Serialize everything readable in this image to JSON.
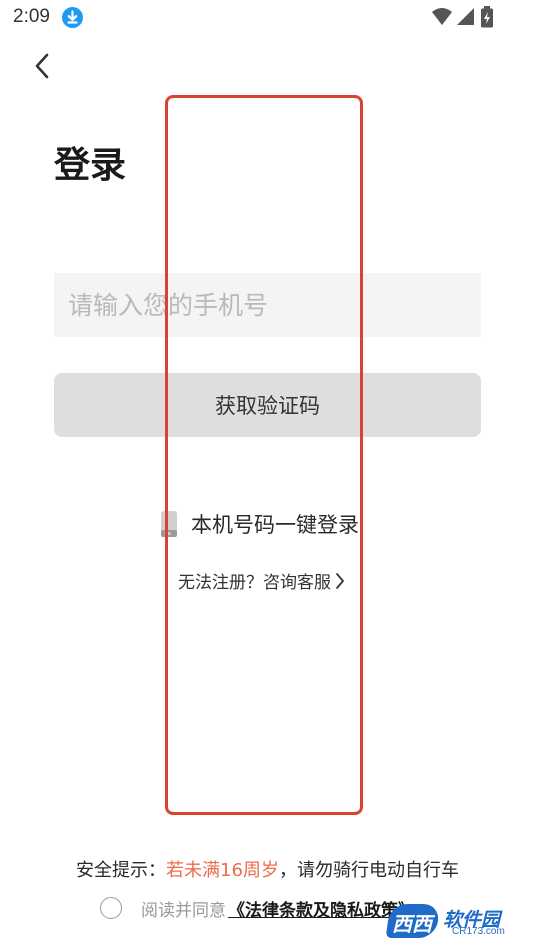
{
  "status_bar": {
    "time": "2:09",
    "icons": [
      "download-icon",
      "wifi-icon",
      "signal-icon",
      "battery-icon"
    ]
  },
  "header": {
    "back_icon": "chevron-left-icon"
  },
  "title": "登录",
  "phone_input": {
    "placeholder": "请输入您的手机号",
    "value": ""
  },
  "get_code_button": "获取验证码",
  "one_key_login": {
    "icon": "phone-icon",
    "label": "本机号码一键登录"
  },
  "help_link": {
    "label": "无法注册？咨询客服",
    "icon": "chevron-right-icon"
  },
  "safety_tip": {
    "prefix": "安全提示：",
    "warning": "若未满16周岁",
    "suffix": "，请勿骑行电动自行车"
  },
  "agreement": {
    "checked": false,
    "text": "阅读并同意",
    "link": "《法律条款及隐私政策》"
  },
  "watermark": {
    "logo": "西西",
    "name": "软件园",
    "url": "CR173.com"
  },
  "colors": {
    "accent_warning": "#ec6b4c",
    "highlight_box": "#d9442e",
    "button_bg": "#dedede",
    "input_bg": "#f4f4f4"
  }
}
